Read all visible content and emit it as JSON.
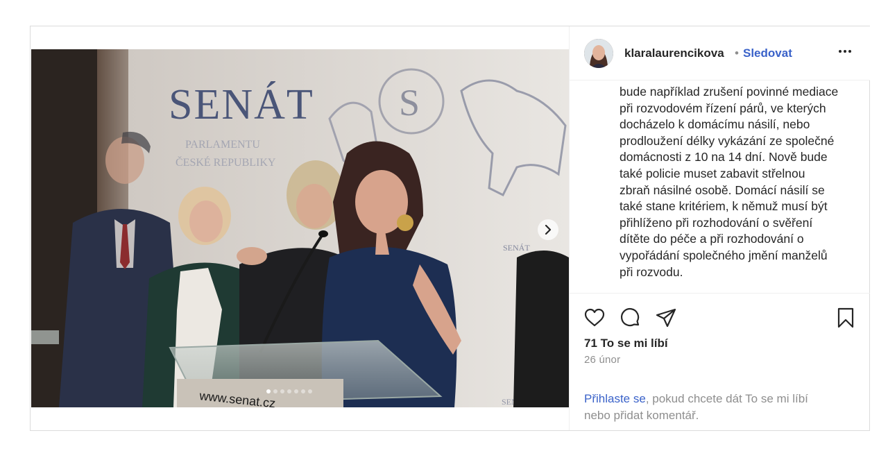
{
  "header": {
    "username": "klaralaurencikova",
    "separator": "•",
    "follow_label": "Sledovat"
  },
  "photo": {
    "backdrop_title": "SENÁT",
    "backdrop_subtitle_1": "PARLAMENTU",
    "backdrop_subtitle_2": "ČESKÉ REPUBLIKY",
    "podium_text": "www.senat.cz",
    "side_logo_text": "SENÁT"
  },
  "carousel": {
    "dot_count": 7,
    "active_dot": 0
  },
  "caption": {
    "lines": [
      "bude například zrušení povinné mediace",
      "při rozvodovém řízení párů, ve kterých",
      "docházelo k domácímu násilí, nebo",
      "prodloužení délky vykázání ze společné",
      "domácnosti z 10 na 14 dní. Nově bude",
      "také policie muset zabavit střelnou",
      "zbraň násilné osobě. Domácí násilí se",
      "také stane kritériem, k němuž musí být",
      "přihlíženo při rozhodování o svěření",
      "dítěte do péče a při rozhodování o",
      "vypořádání společného jmění manželů",
      "při rozvodu."
    ]
  },
  "actions": {
    "icons": [
      "heart-icon",
      "comment-icon",
      "share-icon",
      "bookmark-icon"
    ]
  },
  "likes_text": "71 To se mi líbí",
  "date_text": "26 únor",
  "login_prompt": {
    "link": "Přihlaste se",
    "rest_line1": ", pokud chcete dát To se mi líbí",
    "rest_line2": "nebo přidat komentář."
  },
  "colors": {
    "link_blue": "#3a62c9",
    "muted_gray": "#8e8e8e",
    "text": "#262626"
  }
}
